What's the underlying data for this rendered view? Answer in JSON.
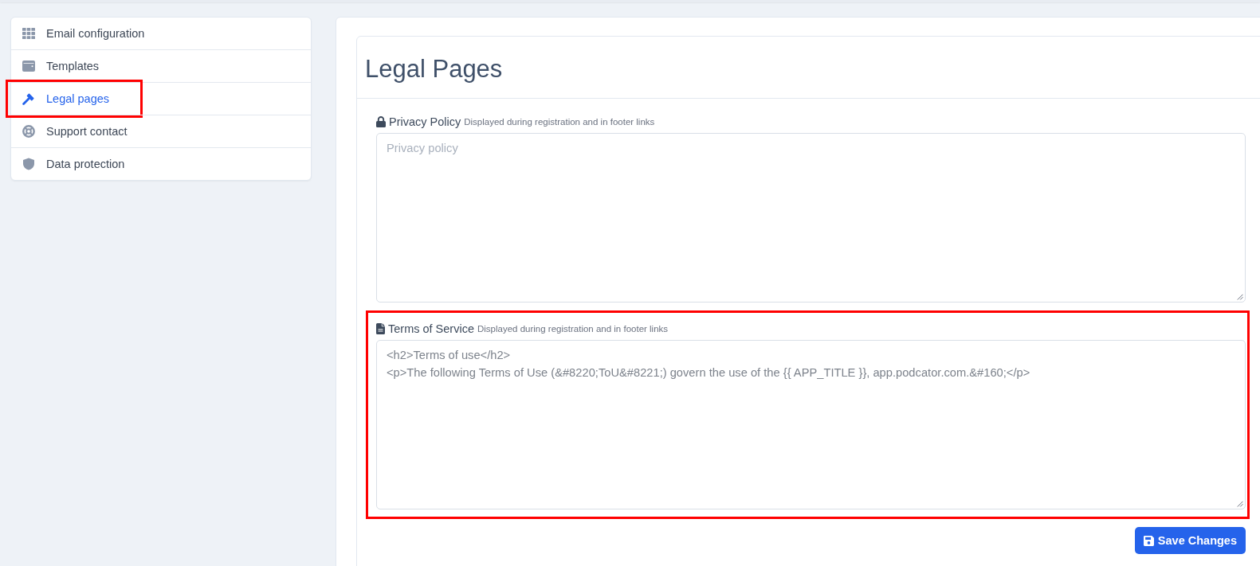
{
  "sidebar": {
    "items": [
      {
        "label": "Email configuration",
        "selected": false,
        "highlighted": false
      },
      {
        "label": "Templates",
        "selected": false,
        "highlighted": false
      },
      {
        "label": "Legal pages",
        "selected": true,
        "highlighted": true
      },
      {
        "label": "Support contact",
        "selected": false,
        "highlighted": false
      },
      {
        "label": "Data protection",
        "selected": false,
        "highlighted": false
      }
    ]
  },
  "page": {
    "title": "Legal Pages"
  },
  "fields": [
    {
      "label": "Privacy Policy",
      "hint": "Displayed during registration and in footer links",
      "placeholder": "Privacy policy",
      "highlighted": false
    },
    {
      "label": "Terms of Service",
      "hint": "Displayed during registration and in footer links",
      "value": "<h2>Terms of use</h2>\n<p>The following Terms of Use (&#8220;ToU&#8221;) govern the use of the {{ APP_TITLE }}, app.podcator.com.&#160;</p>",
      "highlighted": true
    }
  ],
  "save_button": {
    "label": "Save Changes"
  }
}
